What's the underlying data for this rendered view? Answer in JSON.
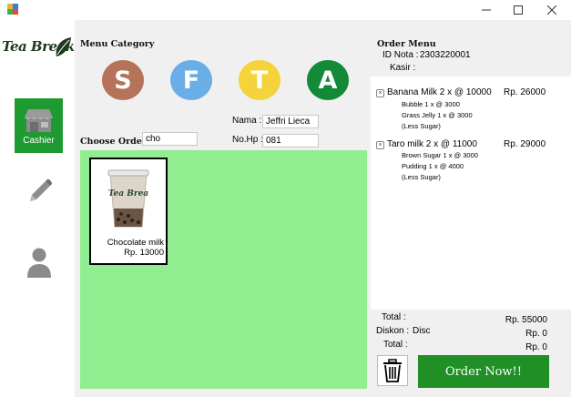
{
  "window": {
    "minimize_icon": "minimize-icon",
    "maximize_icon": "maximize-icon",
    "close_icon": "close-icon"
  },
  "sidebar": {
    "logo_text": "Tea Break",
    "nav": [
      {
        "label": "Cashier",
        "icon": "cashier-store-icon",
        "active": true
      },
      {
        "label": "",
        "icon": "pencil-icon",
        "active": false
      },
      {
        "label": "",
        "icon": "user-icon",
        "active": false
      }
    ]
  },
  "menu": {
    "category_title": "Menu Category",
    "categories": [
      {
        "letter": "S",
        "color": "#b5735a"
      },
      {
        "letter": "F",
        "color": "#6aaee8"
      },
      {
        "letter": "T",
        "color": "#f5d33a"
      },
      {
        "letter": "A",
        "color": "#138a37"
      }
    ],
    "choose_order_label": "Choose Order",
    "search_value": "cho",
    "nama_label": "Nama :",
    "nama_value": "Jeffri Lieca",
    "nohp_label": "No.Hp :",
    "nohp_value": "081",
    "grid_color": "#90ee90",
    "products": [
      {
        "name": "Chocolate milk",
        "price": "Rp. 13000"
      }
    ]
  },
  "order": {
    "title": "Order Menu",
    "id_nota_label": "ID Nota :",
    "id_nota_value": "2303220001",
    "kasir_label": "Kasir :",
    "kasir_value": "",
    "items": [
      {
        "name": "Banana Milk 2 x @ 10000",
        "price": "Rp. 26000",
        "details": [
          "Bubble 1 x @ 3000",
          "Grass Jelly 1 x @ 3000",
          "(Less Sugar)"
        ]
      },
      {
        "name": "Taro milk 2 x @ 11000",
        "price": "Rp. 29000",
        "details": [
          "Brown Sugar 1 x @ 3000",
          "Pudding 1 x @ 4000",
          "(Less Sugar)"
        ]
      }
    ],
    "remove_symbol": "×",
    "total_label": "Total :",
    "total_value": "Rp. 55000",
    "diskon_label": "Diskon :",
    "diskon_code": "Disc",
    "diskon_value": "Rp. 0",
    "grand_total_label": "Total :",
    "grand_total_value": "Rp. 0",
    "delete_icon": "trash-icon",
    "order_button": "Order Now!!",
    "accent": "#1f8f26"
  }
}
